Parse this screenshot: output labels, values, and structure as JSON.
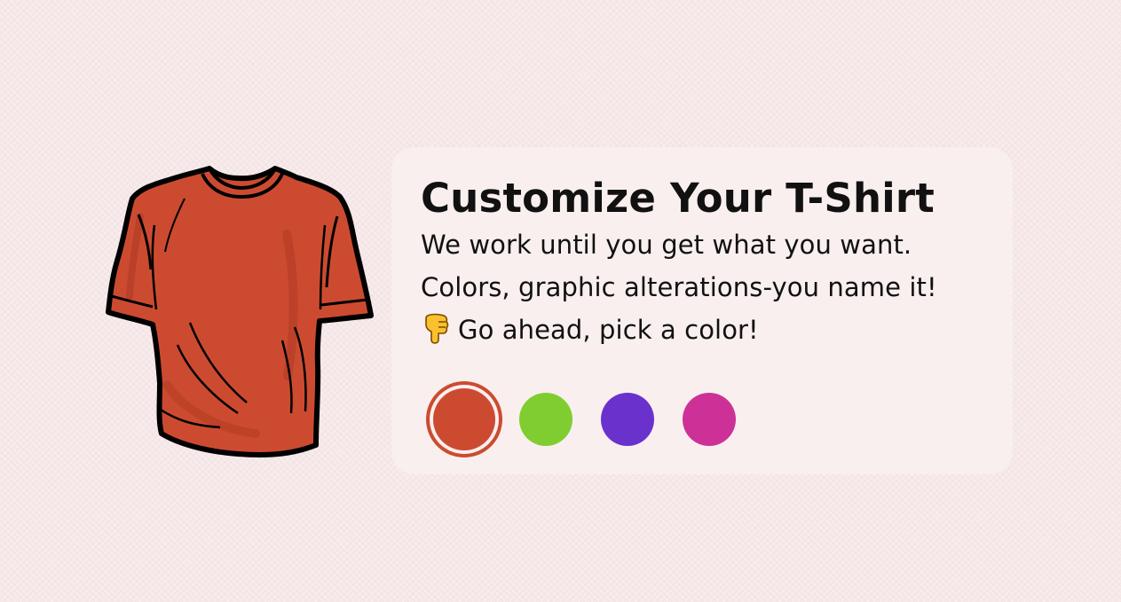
{
  "header": {
    "title": "Customize Your T-Shirt"
  },
  "body_text": {
    "line1": "We work until you get what you want.",
    "line2": "Colors, graphic alterations-you name it!",
    "line3": "Go ahead, pick a color!"
  },
  "icons": {
    "pointing_hand": "backhand-index-pointing-down-icon",
    "shirt": "t-shirt-icon"
  },
  "shirt": {
    "color": "#cc4b30"
  },
  "colors": {
    "options": [
      "#cc4b30",
      "#80cd31",
      "#6a31cd",
      "#cd3197"
    ],
    "selected": "#cc4b30"
  }
}
